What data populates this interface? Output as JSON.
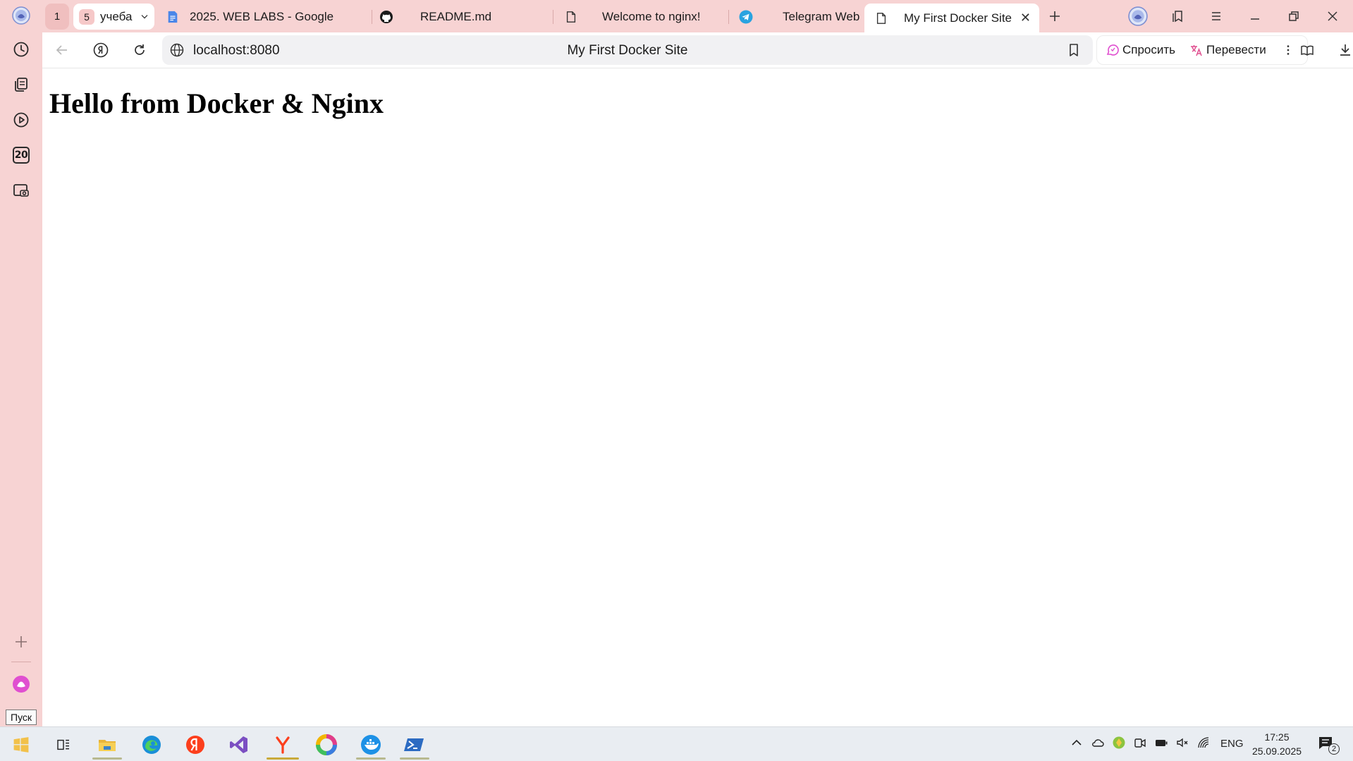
{
  "sidebar": {
    "tooltip": "Пуск",
    "days_badge": "20"
  },
  "tabs": {
    "group1_count": "1",
    "group2_count": "5",
    "group2_label": "учеба",
    "items": [
      {
        "label": "2025. WEB LABS - Google"
      },
      {
        "label": "README.md"
      },
      {
        "label": "Welcome to nginx!"
      },
      {
        "label": "Telegram Web"
      },
      {
        "label": "My First Docker Site"
      }
    ],
    "close_glyph": "✕"
  },
  "toolbar": {
    "url": "localhost:8080",
    "page_title": "My First Docker Site",
    "ask_label": "Спросить",
    "translate_label": "Перевести"
  },
  "page": {
    "heading": "Hello from Docker & Nginx"
  },
  "taskbar": {
    "language": "ENG",
    "time": "17:25",
    "date": "25.09.2025",
    "notifications": "2"
  },
  "colors": {
    "chrome_bg": "#f7d3d3",
    "page_bg": "#ffffff",
    "taskbar_bg": "#e9edf2",
    "alice_accent": "#e04fd0",
    "yandex_red": "#fc3f1d"
  }
}
